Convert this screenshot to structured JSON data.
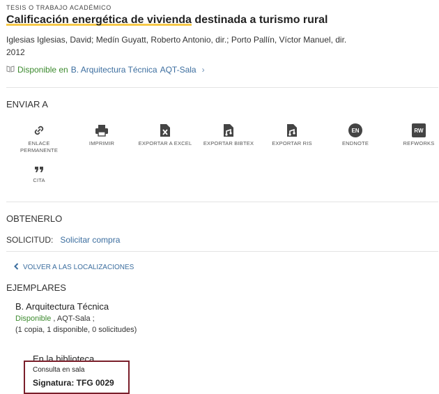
{
  "record": {
    "type_label": "TESIS O TRABAJO ACADÉMICO",
    "title_highlight": "Calificación energética de vivienda",
    "title_rest": " destinada a turismo rural",
    "authors": "Iglesias Iglesias, David; Medín Guyatt, Roberto Antonio, dir.; Porto Pallín, Víctor Manuel, dir.",
    "year": "2012",
    "availability": {
      "status": "Disponible en",
      "library": "B. Arquitectura Técnica",
      "location": "AQT-Sala",
      "chevron": "›"
    }
  },
  "send_to": {
    "heading": "ENVIAR A",
    "items": [
      {
        "label": "ENLACE PERMANENTE",
        "icon": "link-icon"
      },
      {
        "label": "IMPRIMIR",
        "icon": "print-icon"
      },
      {
        "label": "EXPORTAR A EXCEL",
        "icon": "excel-file-icon"
      },
      {
        "label": "EXPORTAR BIBTEX",
        "icon": "bibtex-file-icon"
      },
      {
        "label": "EXPORTAR RIS",
        "icon": "ris-file-icon"
      },
      {
        "label": "ENDNOTE",
        "icon": "endnote-icon",
        "badge": "EN"
      },
      {
        "label": "REFWORKS",
        "icon": "refworks-icon",
        "badge": "RW"
      },
      {
        "label": "CITA",
        "icon": "quote-icon"
      }
    ]
  },
  "get_it": {
    "heading": "OBTENERLO",
    "request_label": "SOLICITUD:",
    "request_link": "Solicitar compra",
    "back_link": "VOLVER A LAS LOCALIZACIONES",
    "items_heading": "EJEMPLARES",
    "library_name": "B. Arquitectura Técnica",
    "status": "Disponible",
    "location": " , AQT-Sala ;",
    "counts": "(1 copia, 1 disponible, 0 solicitudes)",
    "in_library": "En la biblioteca",
    "policy": "Consulta en sala",
    "call_number": "Signatura: TFG 0029"
  },
  "colors": {
    "link": "#3c6e9f",
    "available": "#3c8a2e",
    "highlight": "#f7c948",
    "callbox_border": "#7a1e2a"
  }
}
